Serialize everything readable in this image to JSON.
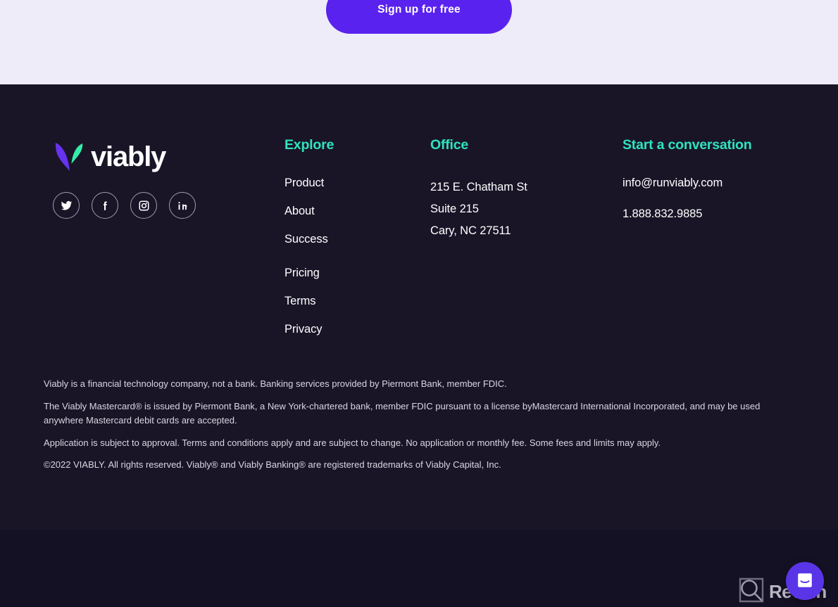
{
  "cta": {
    "signup_label": "Sign up for free",
    "button_color": "#5a22ef",
    "band_color": "#efecfa"
  },
  "footer": {
    "background_color": "#191527",
    "accent_color": "#2fe3c0",
    "brand": {
      "wordmark": "viably",
      "logo_purple": "#6633ee",
      "logo_green": "#33eeaa",
      "socials": [
        {
          "name": "twitter-icon",
          "label": "Twitter"
        },
        {
          "name": "facebook-icon",
          "label": "Facebook"
        },
        {
          "name": "instagram-icon",
          "label": "Instagram"
        },
        {
          "name": "linkedin-icon",
          "label": "LinkedIn"
        }
      ]
    },
    "explore": {
      "heading": "Explore",
      "links": [
        "Product",
        "About",
        "Success",
        "Pricing",
        "Terms",
        "Privacy"
      ]
    },
    "office": {
      "heading": "Office",
      "address_line1": "215 E. Chatham St",
      "address_line2": "Suite 215",
      "address_line3": "Cary, NC 27511"
    },
    "conversation": {
      "heading": "Start a conversation",
      "email": "info@runviably.com",
      "phone": "1.888.832.9885"
    },
    "legal": {
      "line1": "Viably is a financial technology company, not a bank. Banking services provided by Piermont Bank, member FDIC.",
      "line2": "The Viably Mastercard® is issued by Piermont Bank, a New York-chartered bank, member FDIC pursuant to a license byMastercard International Incorporated, and may be used anywhere Mastercard debit cards are accepted.",
      "line3": "Application is subject to approval. Terms and conditions apply and are subject to change. No application or monthly fee. Some fees and limits may apply.",
      "line4": "©2022 VIABLY. All rights reserved. Viably® and Viably Banking® are registered trademarks of Viably Capital, Inc."
    }
  },
  "widgets": {
    "watermark_text": "Revain",
    "watermark_icon": "revain-logo-icon",
    "chat_icon": "intercom-chat-icon",
    "chat_color": "#5a35e8"
  }
}
